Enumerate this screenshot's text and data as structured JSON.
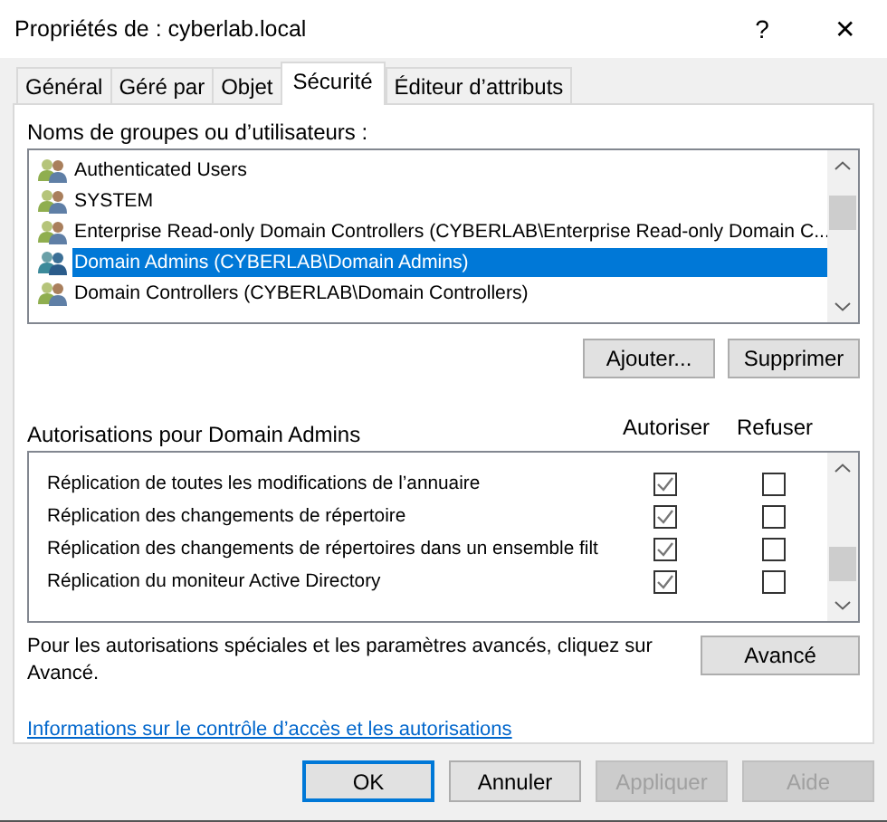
{
  "window": {
    "title": "Propriétés de : cyberlab.local",
    "help": "?",
    "close": "✕"
  },
  "tabs": [
    {
      "label": "Général",
      "selected": false
    },
    {
      "label": "Géré par",
      "selected": false
    },
    {
      "label": "Objet",
      "selected": false
    },
    {
      "label": "Sécurité",
      "selected": true
    },
    {
      "label": "Éditeur d’attributs",
      "selected": false
    }
  ],
  "groups": {
    "label": "Noms de groupes ou d’utilisateurs :",
    "items": [
      {
        "name": "Authenticated Users",
        "selected": false
      },
      {
        "name": "SYSTEM",
        "selected": false
      },
      {
        "name": "Enterprise Read-only Domain Controllers (CYBERLAB\\Enterprise Read-only Domain C...",
        "selected": false
      },
      {
        "name": "Domain Admins (CYBERLAB\\Domain Admins)",
        "selected": true
      },
      {
        "name": "Domain Controllers (CYBERLAB\\Domain Controllers)",
        "selected": false
      }
    ],
    "buttons": [
      "Ajouter...",
      "Supprimer"
    ]
  },
  "permissions": {
    "label": "Autorisations pour Domain Admins",
    "columns": [
      "Autoriser",
      "Refuser"
    ],
    "rows": [
      {
        "name": "Réplication de toutes les modifications de l’annuaire",
        "allow": true,
        "deny": false
      },
      {
        "name": "Réplication des changements de répertoire",
        "allow": true,
        "deny": false
      },
      {
        "name": "Réplication des changements de répertoires dans un ensemble filt",
        "allow": true,
        "deny": false
      },
      {
        "name": "Réplication du moniteur Active Directory",
        "allow": true,
        "deny": false
      }
    ]
  },
  "advanced": {
    "text": "Pour les autorisations spéciales et les paramètres avancés, cliquez sur Avancé.",
    "button": "Avancé"
  },
  "link": "Informations sur le contrôle d’accès et les autorisations",
  "footer_buttons": [
    {
      "label": "OK",
      "disabled": false,
      "default": true
    },
    {
      "label": "Annuler",
      "disabled": false,
      "default": false
    },
    {
      "label": "Appliquer",
      "disabled": true,
      "default": false
    },
    {
      "label": "Aide",
      "disabled": true,
      "default": false
    }
  ]
}
